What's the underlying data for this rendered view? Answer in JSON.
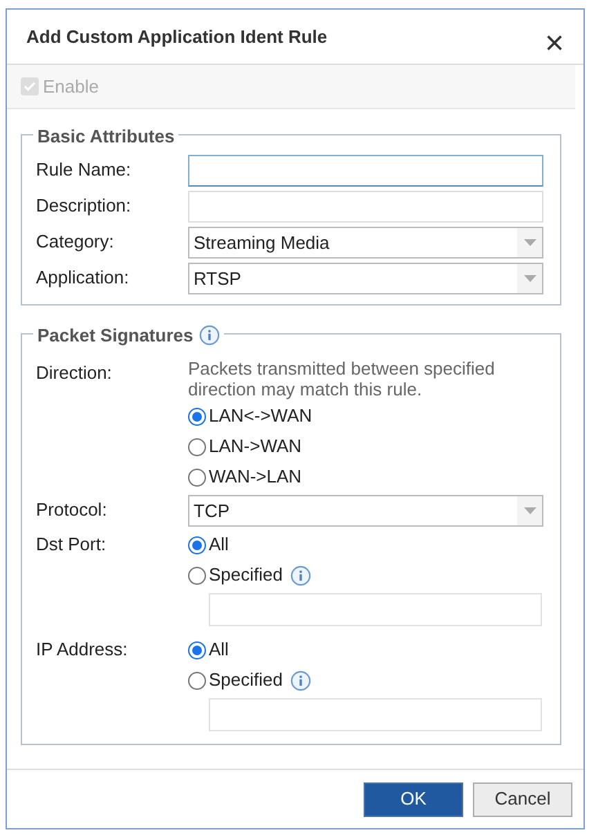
{
  "dialog": {
    "title": "Add Custom Application Ident Rule",
    "close": "×"
  },
  "enable": {
    "label": "Enable",
    "checked": true,
    "disabled": true
  },
  "basic_attributes": {
    "legend": "Basic Attributes",
    "fields": [
      {
        "kind": "text",
        "label": "Rule Name:",
        "focused": true
      },
      {
        "kind": "text",
        "label": "Description:",
        "focused": false
      },
      {
        "kind": "select",
        "label": "Category:",
        "value": "Streaming Media"
      },
      {
        "kind": "select",
        "label": "Application:",
        "value": "RTSP"
      }
    ]
  },
  "packet_signatures": {
    "legend": "Packet Signatures",
    "rows": [
      {
        "kind": "radios",
        "label": "Direction:",
        "note": "Packets transmitted between specified direction may match this rule.",
        "options": [
          {
            "kind": "plain",
            "label": "LAN<->WAN",
            "selected": true
          },
          {
            "kind": "plain",
            "label": "LAN->WAN",
            "selected": false
          },
          {
            "kind": "plain",
            "label": "WAN->LAN",
            "selected": false
          }
        ]
      },
      {
        "kind": "select",
        "label": "Protocol:",
        "value": "TCP"
      },
      {
        "kind": "radios_input",
        "label": "Dst Port:",
        "options": [
          {
            "kind": "plain",
            "label": "All",
            "selected": true
          },
          {
            "kind": "info",
            "label": "Specified",
            "selected": false
          }
        ]
      },
      {
        "kind": "radios_input",
        "label": "IP Address:",
        "options": [
          {
            "kind": "plain",
            "label": "All",
            "selected": true
          },
          {
            "kind": "info",
            "label": "Specified",
            "selected": false
          }
        ]
      }
    ]
  },
  "buttons": [
    {
      "label": "OK",
      "kind": "primary"
    },
    {
      "label": "Cancel",
      "kind": "secondary"
    }
  ]
}
